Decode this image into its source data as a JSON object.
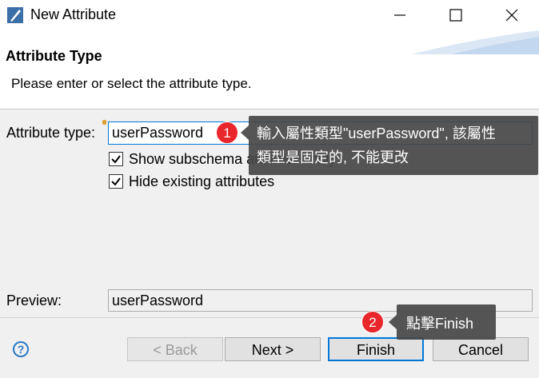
{
  "window": {
    "title": "New Attribute"
  },
  "header": {
    "title": "Attribute Type",
    "description": "Please enter or select the attribute type."
  },
  "form": {
    "attribute_type_label": "Attribute type:",
    "attribute_type_value": "userPassword",
    "show_subschema_label": "Show subschema attributes only",
    "hide_existing_label": "Hide existing attributes",
    "preview_label": "Preview:",
    "preview_value": "userPassword"
  },
  "checkboxes": {
    "show_subschema_checked": true,
    "hide_existing_checked": true
  },
  "buttons": {
    "back": "< Back",
    "next": "Next >",
    "finish": "Finish",
    "cancel": "Cancel"
  },
  "annotations": {
    "step1_number": "1",
    "step1_line1": "輸入屬性類型\"userPassword\", 該屬性",
    "step1_line2": "類型是固定的, 不能更改",
    "step2_number": "2",
    "step2_text": "點擊Finish"
  },
  "colors": {
    "focus_border": "#0078d7",
    "badge": "#e8262b",
    "callout_bg": "#464646"
  }
}
